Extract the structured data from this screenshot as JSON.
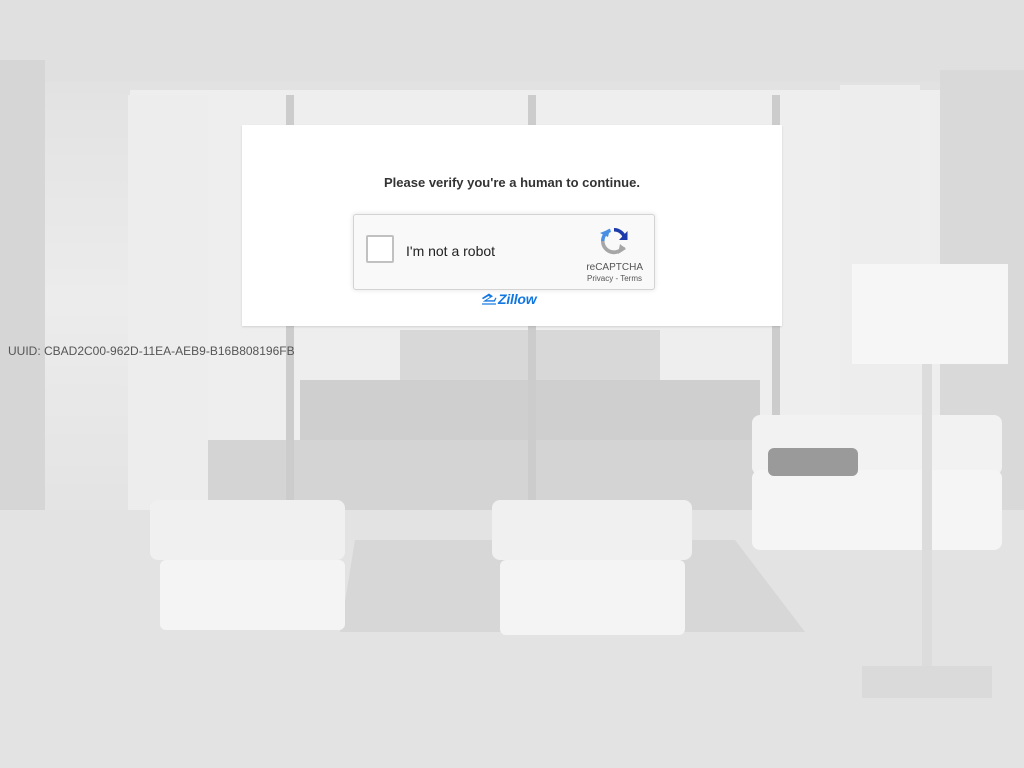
{
  "page": {
    "prompt": "Please verify you're a human to continue.",
    "uuid": "UUID: CBAD2C00-962D-11EA-AEB9-B16B808196FB"
  },
  "recaptcha": {
    "checkbox_label": "I'm not a robot",
    "brand": "reCAPTCHA",
    "privacy_link": "Privacy",
    "separator": " - ",
    "terms_link": "Terms",
    "checked": false,
    "logo_icon": "recaptcha-logo-icon"
  },
  "logo": {
    "text": "Zillow",
    "icon": "zillow-z-icon",
    "color": "#1277e1"
  },
  "colors": {
    "card_background": "#ffffff",
    "prompt_text": "#333333",
    "recaptcha_background": "#f9f9f9",
    "recaptcha_blue": "#1c3aa9",
    "recaptcha_light_blue": "#4a90e2",
    "recaptcha_grey": "#a6a6a6"
  }
}
